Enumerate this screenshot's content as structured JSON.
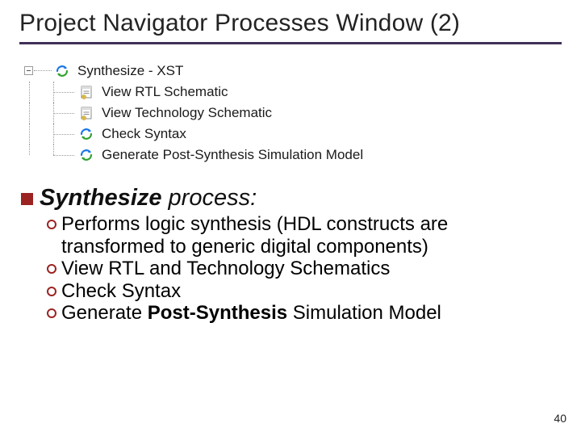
{
  "title": "Project Navigator Processes Window (2)",
  "tree": {
    "root": {
      "label": "Synthesize - XST",
      "icon": "spin-arrows"
    },
    "children": [
      {
        "label": "View RTL Schematic",
        "icon": "report"
      },
      {
        "label": "View Technology Schematic",
        "icon": "report"
      },
      {
        "label": "Check Syntax",
        "icon": "spin-arrows"
      },
      {
        "label": "Generate Post-Synthesis Simulation Model",
        "icon": "spin-arrows"
      }
    ]
  },
  "heading": {
    "bold": "Synthesize",
    "rest": " process:"
  },
  "bullets": [
    {
      "text": "Performs logic synthesis (HDL constructs are transformed to generic digital components)"
    },
    {
      "text": "View RTL and Technology Schematics"
    },
    {
      "text": "Check Syntax"
    },
    {
      "prefix": "Generate ",
      "bold": "Post-Synthesis",
      "suffix": " Simulation Model"
    }
  ],
  "page_number": "40"
}
